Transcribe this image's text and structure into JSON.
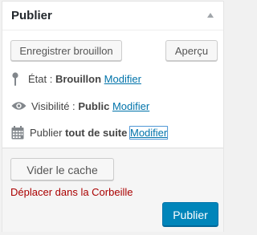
{
  "box": {
    "title": "Publier",
    "toggle_icon": "caret-up-icon"
  },
  "minor_actions": {
    "save_draft_label": "Enregistrer brouillon",
    "preview_label": "Aperçu"
  },
  "status": {
    "icon": "pin-icon",
    "label": "État :",
    "value": "Brouillon",
    "edit_label": "Modifier"
  },
  "visibility": {
    "icon": "eye-icon",
    "label": "Visibilité :",
    "value": "Public",
    "edit_label": "Modifier"
  },
  "schedule": {
    "icon": "calendar-icon",
    "label": "Publier",
    "value": "tout de suite",
    "edit_label": "Modifier"
  },
  "major_actions": {
    "clear_cache_label": "Vider le cache",
    "trash_label": "Déplacer dans la Corbeille",
    "publish_label": "Publier"
  },
  "colors": {
    "link": "#0073aa",
    "trash": "#aa0000",
    "publish_button": "#0085ba"
  }
}
